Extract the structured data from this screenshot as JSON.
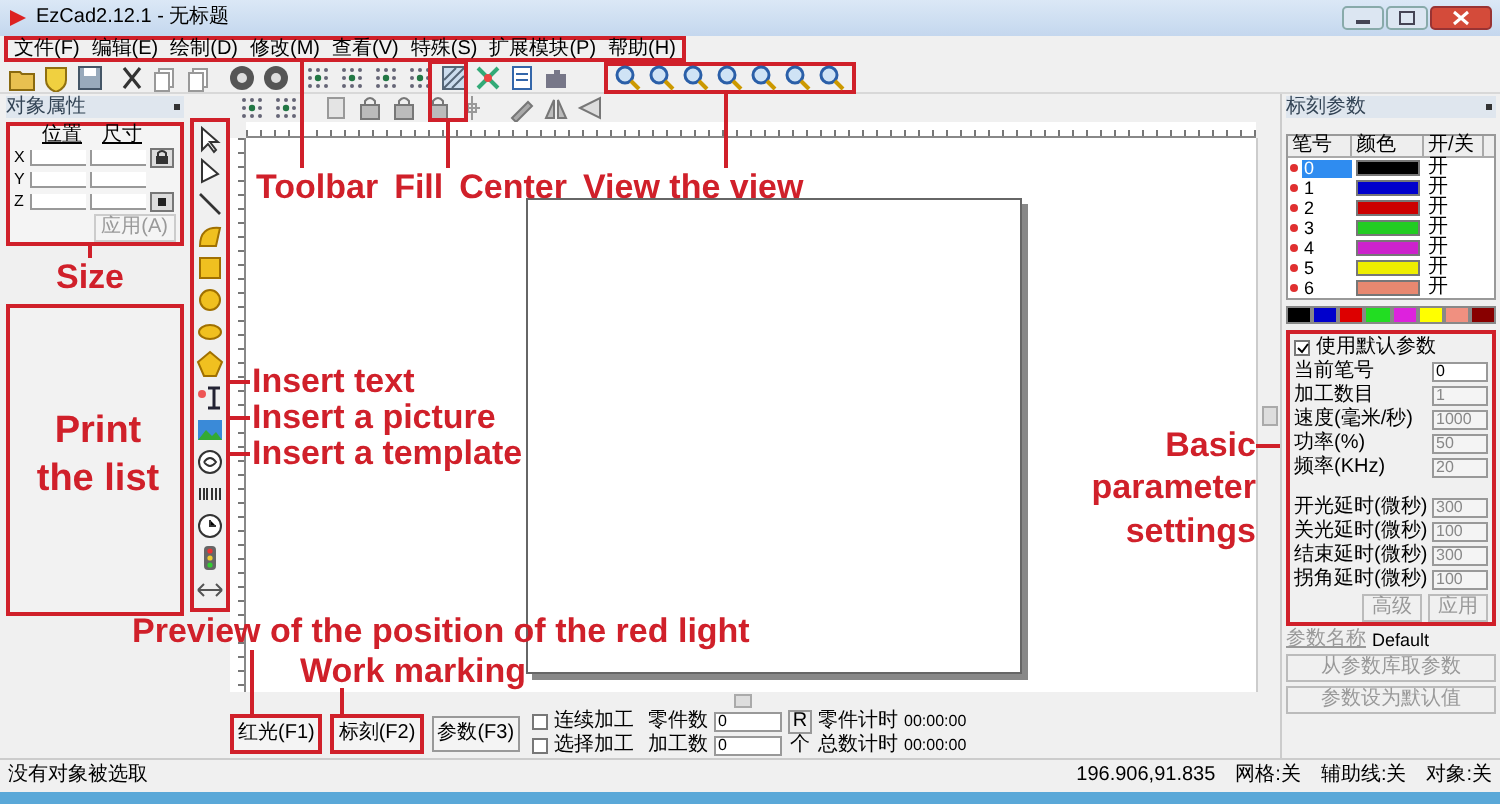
{
  "window": {
    "title": "EzCad2.12.1 - 无标题"
  },
  "menu": [
    "文件(F)",
    "编辑(E)",
    "绘制(D)",
    "修改(M)",
    "查看(V)",
    "特殊(S)",
    "扩展模块(P)",
    "帮助(H)"
  ],
  "object_panel": {
    "title": "对象属性",
    "position_label": "位置",
    "size_label": "尺寸",
    "axes": [
      "X",
      "Y",
      "Z"
    ],
    "apply_button": "应用(A)"
  },
  "mark_panel": {
    "title": "标刻参数",
    "pen_columns": [
      "笔号",
      "颜色",
      "开/关"
    ],
    "pens": [
      {
        "number": "0",
        "color": "#000000",
        "state": "开",
        "selected": true
      },
      {
        "number": "1",
        "color": "#0000cc",
        "state": "开",
        "selected": false
      },
      {
        "number": "2",
        "color": "#cc0000",
        "state": "开",
        "selected": false
      },
      {
        "number": "3",
        "color": "#22cc22",
        "state": "开",
        "selected": false
      },
      {
        "number": "4",
        "color": "#cc22cc",
        "state": "开",
        "selected": false
      },
      {
        "number": "5",
        "color": "#eeee00",
        "state": "开",
        "selected": false
      },
      {
        "number": "6",
        "color": "#e88870",
        "state": "开",
        "selected": false
      }
    ],
    "palette": [
      {
        "color": "#000000"
      },
      {
        "color": "#0000cc"
      },
      {
        "color": "#dd0000"
      },
      {
        "color": "#22dd22"
      },
      {
        "color": "#dd22dd"
      },
      {
        "color": "#ffff00"
      },
      {
        "color": "#f09080"
      },
      {
        "color": "#880000"
      }
    ],
    "use_default": {
      "label": "使用默认参数",
      "checked": true
    },
    "params": [
      {
        "label": "当前笔号",
        "value": "0"
      },
      {
        "label": "加工数目",
        "value": "1"
      },
      {
        "label": "速度(毫米/秒)",
        "value": "1000"
      },
      {
        "label": "功率(%)",
        "value": "50"
      },
      {
        "label": "频率(KHz)",
        "value": "20"
      },
      {
        "label": "开光延时(微秒)",
        "value": "300"
      },
      {
        "label": "关光延时(微秒)",
        "value": "100"
      },
      {
        "label": "结束延时(微秒)",
        "value": "300"
      },
      {
        "label": "拐角延时(微秒)",
        "value": "100"
      }
    ],
    "buttons": [
      "高级",
      "应用"
    ],
    "name_label": "参数名称",
    "name_value": "Default",
    "library_buttons": [
      "从参数库取参数",
      "参数设为默认值"
    ]
  },
  "bottom_bar": {
    "buttons": [
      "红光(F1)",
      "标刻(F2)",
      "参数(F3)"
    ],
    "options": [
      {
        "label": "连续加工",
        "checked": false
      },
      {
        "label": "选择加工",
        "checked": false
      }
    ],
    "counters": [
      {
        "label": "零件数",
        "value": "0",
        "unit": "R"
      },
      {
        "label": "加工数",
        "value": "0",
        "unit": "个"
      }
    ],
    "timers": [
      {
        "label": "零件计时",
        "value": "00:00:00"
      },
      {
        "label": "总数计时",
        "value": "00:00:00"
      }
    ]
  },
  "status_bar": [
    "没有对象被选取",
    "196.906,91.835",
    "网格:关",
    "辅助线:关",
    "对象:关"
  ],
  "annotations": [
    {
      "text": "Toolbar"
    },
    {
      "text": "Fill"
    },
    {
      "text": "Center"
    },
    {
      "text": "View the view"
    },
    {
      "text": "Size"
    },
    {
      "text": "Print the list"
    },
    {
      "text": "Insert text"
    },
    {
      "text": "Insert a picture"
    },
    {
      "text": "Insert a template"
    },
    {
      "text": "Basic parameter settings"
    },
    {
      "text": "Preview of the position of the red light"
    },
    {
      "text": "Work marking"
    }
  ]
}
